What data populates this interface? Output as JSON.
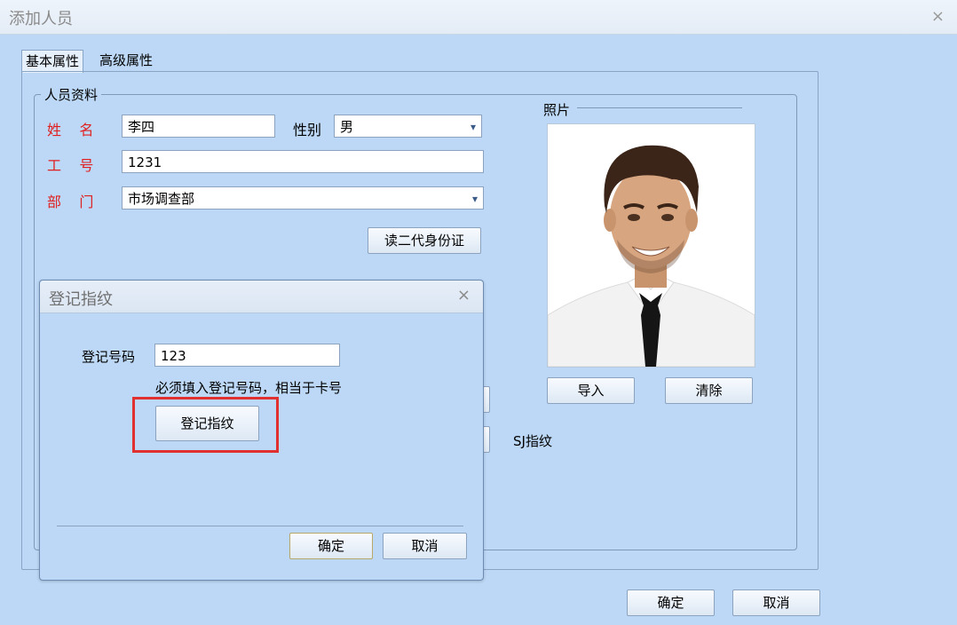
{
  "window": {
    "title": "添加人员",
    "close_glyph": "×"
  },
  "tabs": [
    {
      "label": "基本属性"
    },
    {
      "label": "高级属性"
    }
  ],
  "person_group": {
    "label": "人员资料",
    "name_label": "姓    名",
    "name_value": "李四",
    "gender_label": "性别",
    "gender_value": "男",
    "id_label": "工    号",
    "id_value": "1231",
    "dept_label": "部    门",
    "dept_value": "市场调查部",
    "read_id_button": "读二代身份证"
  },
  "photo": {
    "label": "照片",
    "import_button": "导入",
    "clear_button": "清除"
  },
  "fingerprint_label": "SJ指纹",
  "footer": {
    "ok": "确定",
    "cancel": "取消"
  },
  "dialog": {
    "title": "登记指纹",
    "close_glyph": "×",
    "reg_label": "登记号码",
    "reg_value": "123",
    "hint": "必须填入登记号码，相当于卡号",
    "register_button": "登记指纹",
    "ok": "确定",
    "cancel": "取消"
  },
  "colors": {
    "background": "#bcd8f6",
    "required_label": "#e02020",
    "highlight_box": "#e03030"
  }
}
